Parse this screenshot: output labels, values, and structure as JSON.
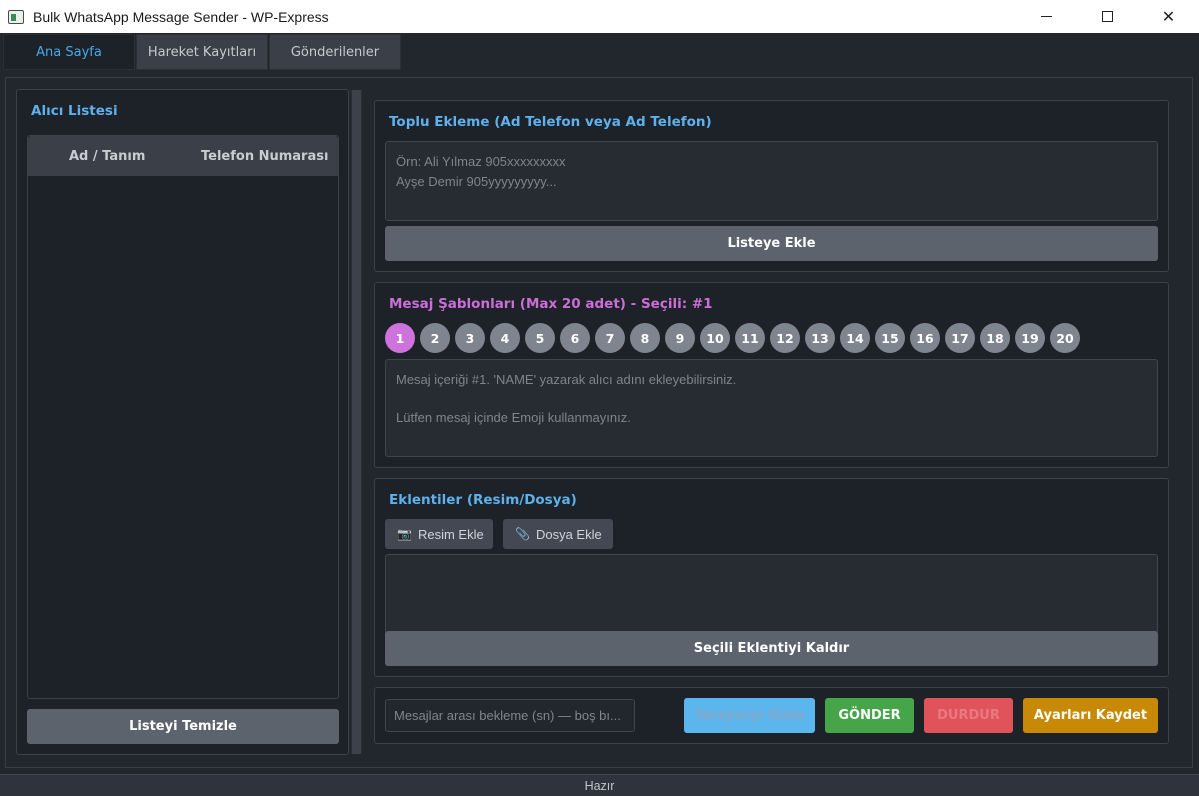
{
  "window": {
    "title": "Bulk WhatsApp Message Sender - WP-Express",
    "minimize": "—",
    "maximize": "☐",
    "close": "✕"
  },
  "tabs": [
    {
      "label": "Ana Sayfa",
      "active": true
    },
    {
      "label": "Hareket Kayıtları",
      "active": false
    },
    {
      "label": "Gönderilenler",
      "active": false
    }
  ],
  "recipients": {
    "title": "Alıcı Listesi",
    "columns": [
      "Ad / Tanım",
      "Telefon Numarası"
    ],
    "rows": [],
    "clear_button": "Listeyi Temizle"
  },
  "bulk_add": {
    "title": "Toplu Ekleme (Ad Telefon veya Ad Telefon)",
    "placeholder_line1": "Örn: Ali Yılmaz 905xxxxxxxxx",
    "placeholder_line2": "Ayşe Demir 905yyyyyyyyy...",
    "add_button": "Listeye Ekle"
  },
  "templates": {
    "title": "Mesaj Şablonları (Max 20 adet) - Seçili: #1",
    "selected": 1,
    "numbers": [
      "1",
      "2",
      "3",
      "4",
      "5",
      "6",
      "7",
      "8",
      "9",
      "10",
      "11",
      "12",
      "13",
      "14",
      "15",
      "16",
      "17",
      "18",
      "19",
      "20"
    ],
    "placeholder_line1": "Mesaj içeriği #1. 'NAME' yazarak alıcı adını ekleyebilirsiniz.",
    "placeholder_line2": "Lütfen mesaj içinde Emoji kullanmayınız."
  },
  "attachments": {
    "title": "Eklentiler (Resim/Dosya)",
    "image_button": "Resim Ekle",
    "image_icon": "📷",
    "file_button": "Dosya Ekle",
    "file_icon": "📎",
    "items": [],
    "remove_button": "Seçili Eklentiyi Kaldır"
  },
  "actions": {
    "delay_placeholder": "Mesajlar arası bekleme (sn) — boş bı...",
    "hide_browser": "Tarayıcıyı Gizle",
    "send": "GÖNDER",
    "stop": "DURDUR",
    "save_settings": "Ayarları Kaydet",
    "colors": {
      "hide_browser": "#5bb6ee",
      "send": "#46a549",
      "stop": "#e0535a",
      "save_settings": "#c88a06"
    }
  },
  "status": {
    "text": "Hazır"
  }
}
